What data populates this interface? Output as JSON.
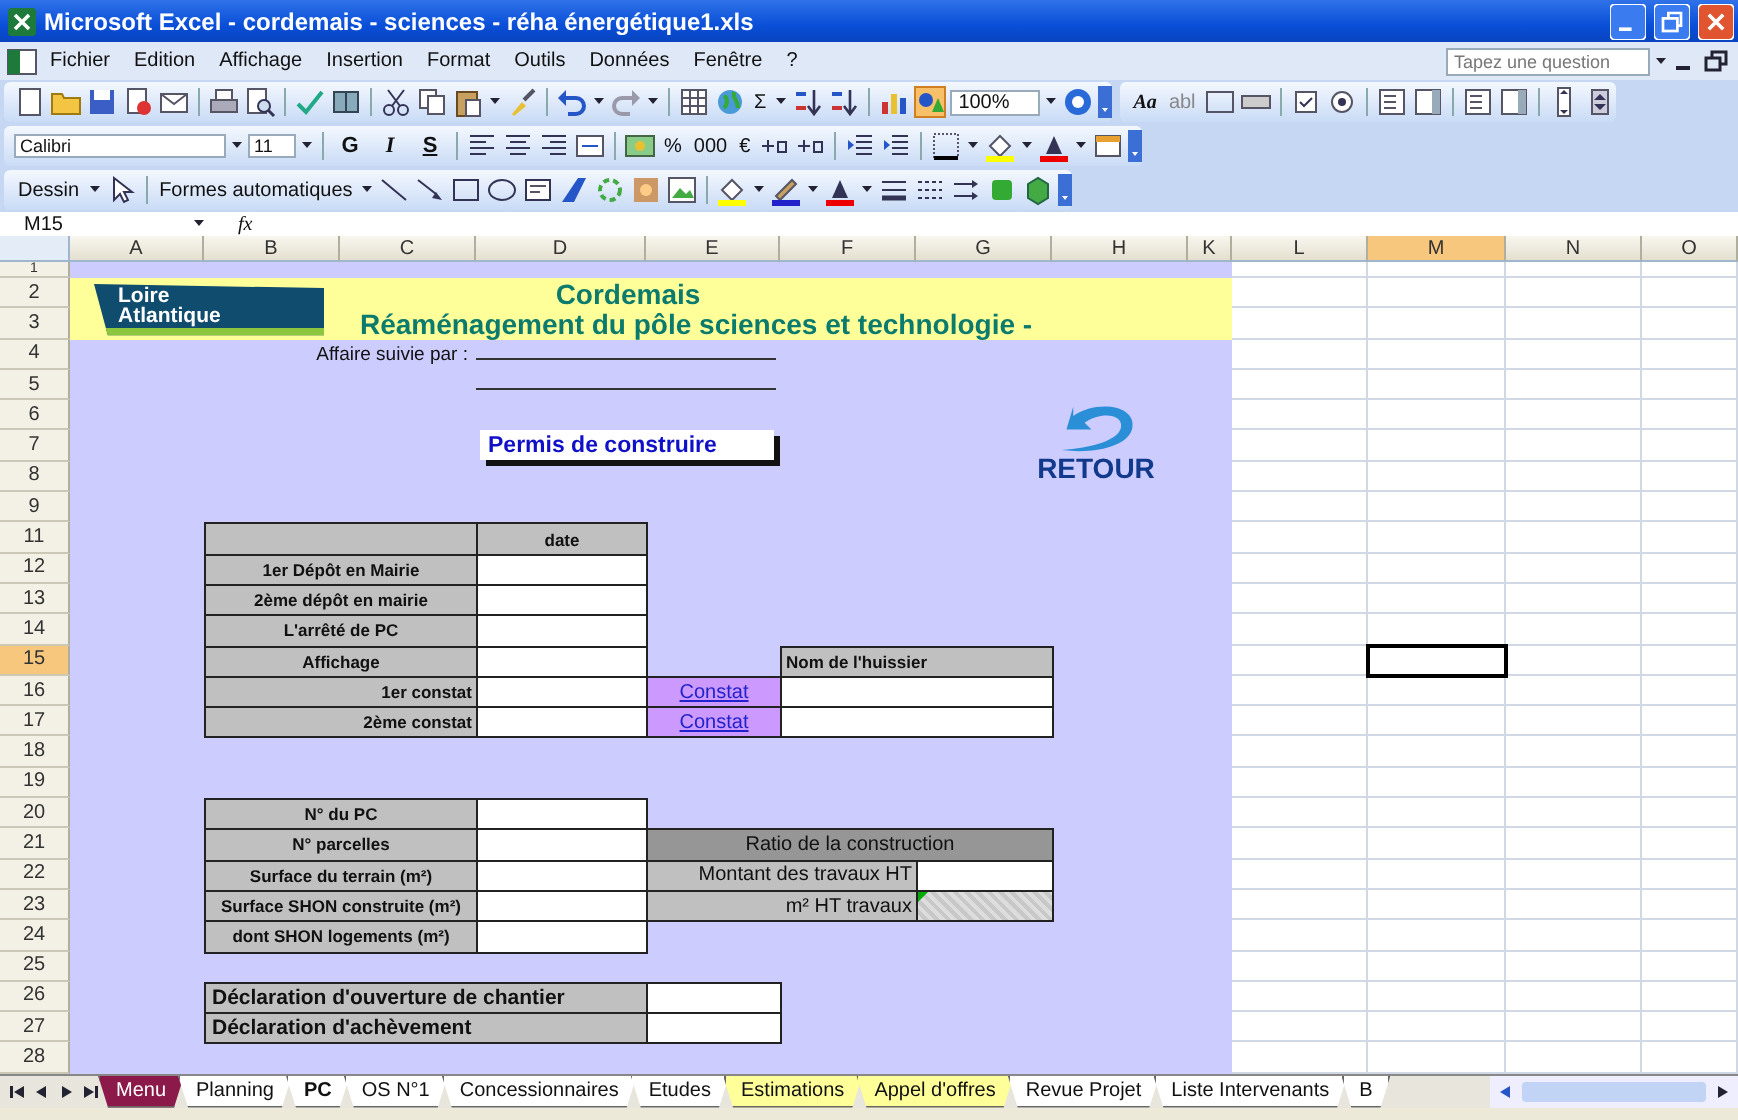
{
  "window": {
    "title": "Microsoft Excel - cordemais - sciences - réha énergétique1.xls"
  },
  "menu": [
    "Fichier",
    "Edition",
    "Affichage",
    "Insertion",
    "Format",
    "Outils",
    "Données",
    "Fenêtre",
    "?"
  ],
  "question_box": {
    "placeholder": "Tapez une question"
  },
  "standard_toolbar": {
    "autosum": "Σ",
    "zoom": "100%"
  },
  "forms_toolbar": {
    "labels": [
      "Aa",
      "abl"
    ]
  },
  "formatting_toolbar": {
    "font": "Calibri",
    "size": "11",
    "styles": [
      "G",
      "I",
      "S"
    ],
    "number_formats": [
      "%",
      "000",
      "€"
    ]
  },
  "drawing_toolbar": {
    "draw_menu": "Dessin",
    "shapes_menu": "Formes automatiques"
  },
  "formula_bar": {
    "name_box": "M15",
    "function_label": "fx"
  },
  "sheet": {
    "columns": [
      {
        "label": "A",
        "selected": false
      },
      {
        "label": "B",
        "selected": false
      },
      {
        "label": "C",
        "selected": false
      },
      {
        "label": "D",
        "selected": false
      },
      {
        "label": "E",
        "selected": false
      },
      {
        "label": "F",
        "selected": false
      },
      {
        "label": "G",
        "selected": false
      },
      {
        "label": "H",
        "selected": false
      },
      {
        "label": "K",
        "selected": false
      },
      {
        "label": "L",
        "selected": false
      },
      {
        "label": "M",
        "selected": true
      },
      {
        "label": "N",
        "selected": false
      },
      {
        "label": "O",
        "selected": false
      }
    ],
    "rows": [
      {
        "label": "1",
        "selected": false
      },
      {
        "label": "2",
        "selected": false
      },
      {
        "label": "3",
        "selected": false
      },
      {
        "label": "4",
        "selected": false
      },
      {
        "label": "5",
        "selected": false
      },
      {
        "label": "6",
        "selected": false
      },
      {
        "label": "7",
        "selected": false
      },
      {
        "label": "8",
        "selected": false
      },
      {
        "label": "9",
        "selected": false
      },
      {
        "label": "11",
        "selected": false
      },
      {
        "label": "12",
        "selected": false
      },
      {
        "label": "13",
        "selected": false
      },
      {
        "label": "14",
        "selected": false
      },
      {
        "label": "15",
        "selected": true
      },
      {
        "label": "16",
        "selected": false
      },
      {
        "label": "17",
        "selected": false
      },
      {
        "label": "18",
        "selected": false
      },
      {
        "label": "19",
        "selected": false
      },
      {
        "label": "20",
        "selected": false
      },
      {
        "label": "21",
        "selected": false
      },
      {
        "label": "22",
        "selected": false
      },
      {
        "label": "23",
        "selected": false
      },
      {
        "label": "24",
        "selected": false
      },
      {
        "label": "25",
        "selected": false
      },
      {
        "label": "26",
        "selected": false
      },
      {
        "label": "27",
        "selected": false
      },
      {
        "label": "28",
        "selected": false
      }
    ],
    "logo": "Loire Atlantique",
    "title": "Cordemais",
    "subtitle": "Réaménagement du pôle sciences et technologie -",
    "follow_up_label": "Affaire suivie par :",
    "permit_box": "Permis de construire",
    "back_button": "RETOUR",
    "permit_table": {
      "value_header": "date",
      "bailiff_header": "Nom de l'huissier",
      "rows": [
        {
          "label": "1er Dépôt en Mairie",
          "kind": "date"
        },
        {
          "label": "2ème dépôt en mairie",
          "kind": "date"
        },
        {
          "label": "L'arrêté de PC",
          "kind": "date"
        },
        {
          "label": "Affichage",
          "kind": "date"
        },
        {
          "label": "1er constat",
          "kind": "constat",
          "link": "Constat"
        },
        {
          "label": "2ème constat",
          "kind": "constat",
          "link": "Constat"
        }
      ]
    },
    "pc_table": [
      "N° du PC",
      "N° parcelles",
      "Surface du terrain (m²)",
      "Surface SHON construite (m²)",
      "dont SHON logements (m²)"
    ],
    "ratio_table": {
      "title": "Ratio de la construction",
      "rows": [
        {
          "label": "Montant des travaux HT",
          "kind": "input"
        },
        {
          "label": "m² HT travaux",
          "kind": "computed"
        }
      ]
    },
    "declarations": [
      "Déclaration d'ouverture de chantier",
      "Déclaration d'achèvement"
    ]
  },
  "sheet_tabs": [
    {
      "label": "Menu",
      "selected": false,
      "color": "#8b1a4a"
    },
    {
      "label": "Planning",
      "selected": false
    },
    {
      "label": "PC",
      "selected": true
    },
    {
      "label": "OS N°1",
      "selected": false
    },
    {
      "label": "Concessionnaires",
      "selected": false
    },
    {
      "label": "Etudes",
      "selected": false
    },
    {
      "label": "Estimations",
      "selected": false,
      "color": "#ffff99"
    },
    {
      "label": "Appel d'offres",
      "selected": false,
      "color": "#ffff99"
    },
    {
      "label": "Revue Projet",
      "selected": false
    },
    {
      "label": "Liste Intervenants",
      "selected": false
    },
    {
      "label": "B",
      "selected": false
    }
  ]
}
